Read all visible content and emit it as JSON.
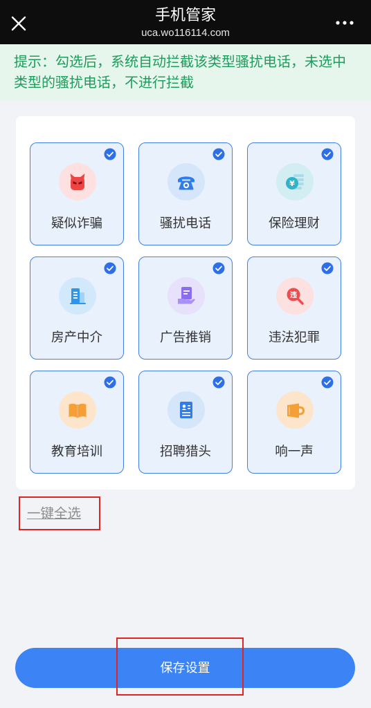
{
  "header": {
    "title": "手机管家",
    "subtitle": "uca.wo116114.com",
    "close_icon": "close-icon",
    "more_icon": "more-icon"
  },
  "notice": {
    "text": "提示：勾选后，系统自动拦截该类型骚扰电话，未选中类型的骚扰电话，不进行拦截"
  },
  "categories": [
    {
      "label": "疑似诈骗",
      "icon": "devil-icon",
      "checked": true
    },
    {
      "label": "骚扰电话",
      "icon": "phone-icon",
      "checked": true
    },
    {
      "label": "保险理财",
      "icon": "coin-icon",
      "icon_glyph": "¥",
      "checked": true
    },
    {
      "label": "房产中介",
      "icon": "building-icon",
      "checked": true
    },
    {
      "label": "广告推销",
      "icon": "advert-icon",
      "checked": true
    },
    {
      "label": "违法犯罪",
      "icon": "magnifier-icon",
      "icon_glyph": "违",
      "checked": true
    },
    {
      "label": "教育培训",
      "icon": "book-icon",
      "checked": true
    },
    {
      "label": "招聘猎头",
      "icon": "resume-icon",
      "checked": true
    },
    {
      "label": "响一声",
      "icon": "cup-icon",
      "checked": true
    }
  ],
  "select_all": {
    "label": "一键全选"
  },
  "save_button": {
    "label": "保存设置"
  },
  "colors": {
    "accent": "#3c83f6",
    "notice_text": "#1e9c5c",
    "notice_bg": "#e6f6ed",
    "tile_bg": "#e9f1fd",
    "annotation": "#e02424"
  }
}
